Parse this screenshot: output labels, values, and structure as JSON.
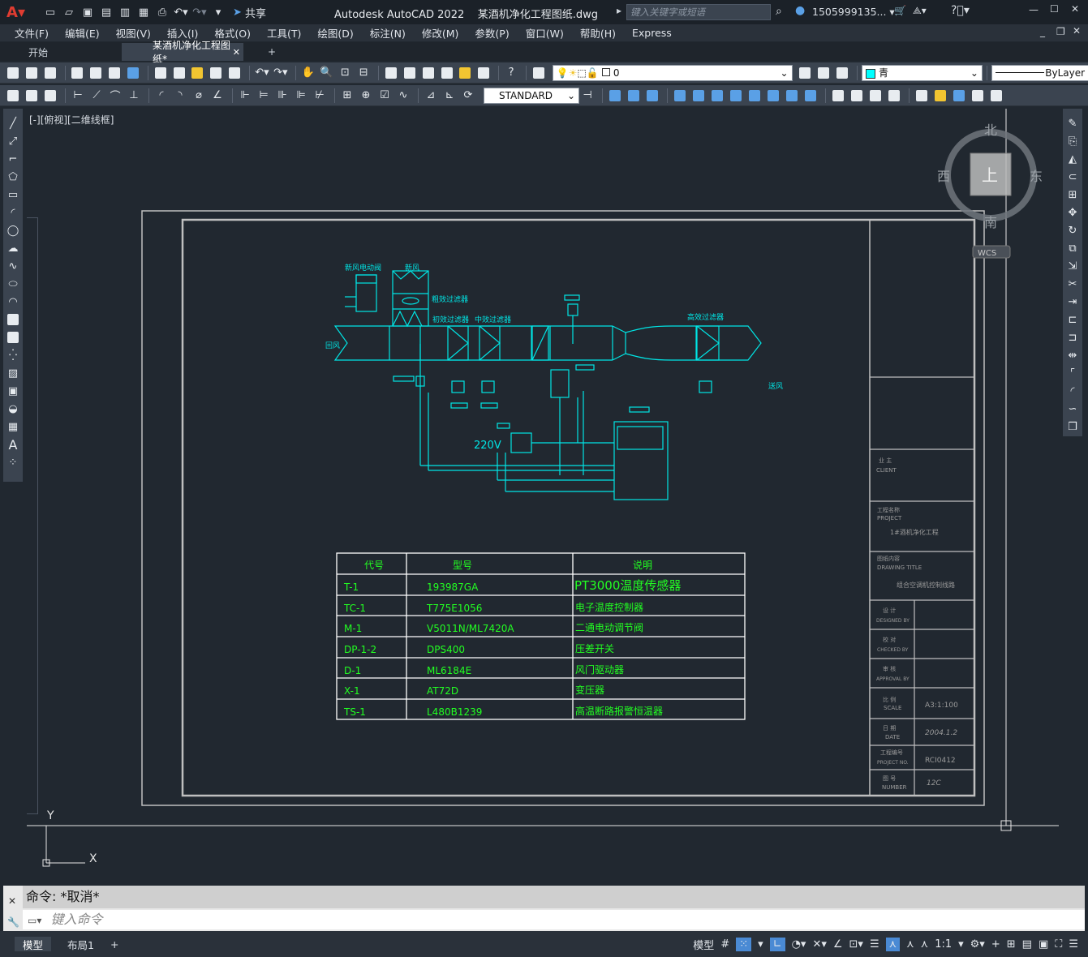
{
  "window": {
    "app_logo": "A",
    "quick_access": [
      "new-icon",
      "open-icon",
      "save-icon",
      "saveas-icon",
      "publish-icon",
      "plot-icon",
      "print-icon",
      "undo-icon",
      "redo-icon"
    ],
    "share_label": "共享",
    "title": "Autodesk AutoCAD 2022    某酒机净化工程图纸.dwg",
    "search_placeholder": "键入关键字或短语",
    "user": "1505999135... ▾"
  },
  "menu": [
    "文件(F)",
    "编辑(E)",
    "视图(V)",
    "插入(I)",
    "格式(O)",
    "工具(T)",
    "绘图(D)",
    "标注(N)",
    "修改(M)",
    "参数(P)",
    "窗口(W)",
    "帮助(H)",
    "Express"
  ],
  "tabs": {
    "start": "开始",
    "active": "某酒机净化工程图纸*",
    "close": "✕",
    "add": "+"
  },
  "toolbar": {
    "layer_value": "0",
    "color_value": "青",
    "linetype_value": "ByLayer",
    "textstyle_value": "STANDARD"
  },
  "viewport_label": "[-][俯视][二维线框]",
  "viewcube": {
    "north": "北",
    "south": "南",
    "east": "东",
    "west": "西",
    "top": "上",
    "wcs": "WCS"
  },
  "ucs": {
    "y": "Y",
    "x": "X"
  },
  "drawing": {
    "labels": {
      "fresh_air_valve": "新风电动阀",
      "fresh_air": "新风",
      "coarse_filter1": "粗效过滤器",
      "coarse_filter2": "初效过滤器",
      "mid_filter": "中效过滤器",
      "hi_filter": "高效过滤器",
      "return_air": "回风",
      "supply_air": "送风",
      "volt": "220V"
    },
    "table_headers": [
      "代号",
      "型号",
      "说明"
    ],
    "table_rows": [
      [
        "T-1",
        "193987GA",
        "PT3000温度传感器"
      ],
      [
        "TC-1",
        "T775E1056",
        "电子温度控制器"
      ],
      [
        "M-1",
        "V5011N/ML7420A",
        "二通电动调节阀"
      ],
      [
        "DP-1-2",
        "DPS400",
        "压差开关"
      ],
      [
        "D-1",
        "ML6184E",
        "风门驱动器"
      ],
      [
        "X-1",
        "AT72D",
        "变压器"
      ],
      [
        "TS-1",
        "L480B1239",
        "高温断路报警恒温器"
      ]
    ],
    "title_block": {
      "client_cn": "业 主",
      "client_en": "CLIENT",
      "project_cn": "工程名称",
      "project_en": "PROJECT",
      "project_value": "1#酒机净化工程",
      "drawing_cn": "图纸内容",
      "drawing_en": "DRAWING TITLE",
      "drawing_value": "组合空调机控制线路",
      "designed_cn": "设 计",
      "designed_en": "DESIGNED BY",
      "checked_cn": "校 对",
      "checked_en": "CHECKED BY",
      "approval_cn": "审 核",
      "approval_en": "APPROVAL BY",
      "scale_cn": "比 例",
      "scale_en": "SCALE",
      "scale_value": "A3:1:100",
      "date_cn": "日 期",
      "date_en": "DATE",
      "date_value": "2004.1.2",
      "projno_cn": "工程编号",
      "projno_en": "PROJECT NO.",
      "projno_value": "RCI0412",
      "number_cn": "图 号",
      "number_en": "NUMBER",
      "number_value": "12C"
    }
  },
  "command": {
    "history": "命令: *取消*",
    "placeholder": "键入命令"
  },
  "status": {
    "model_tab": "模型",
    "layout_tab": "布局1",
    "add": "+",
    "model": "模型",
    "scale": "1:1"
  }
}
